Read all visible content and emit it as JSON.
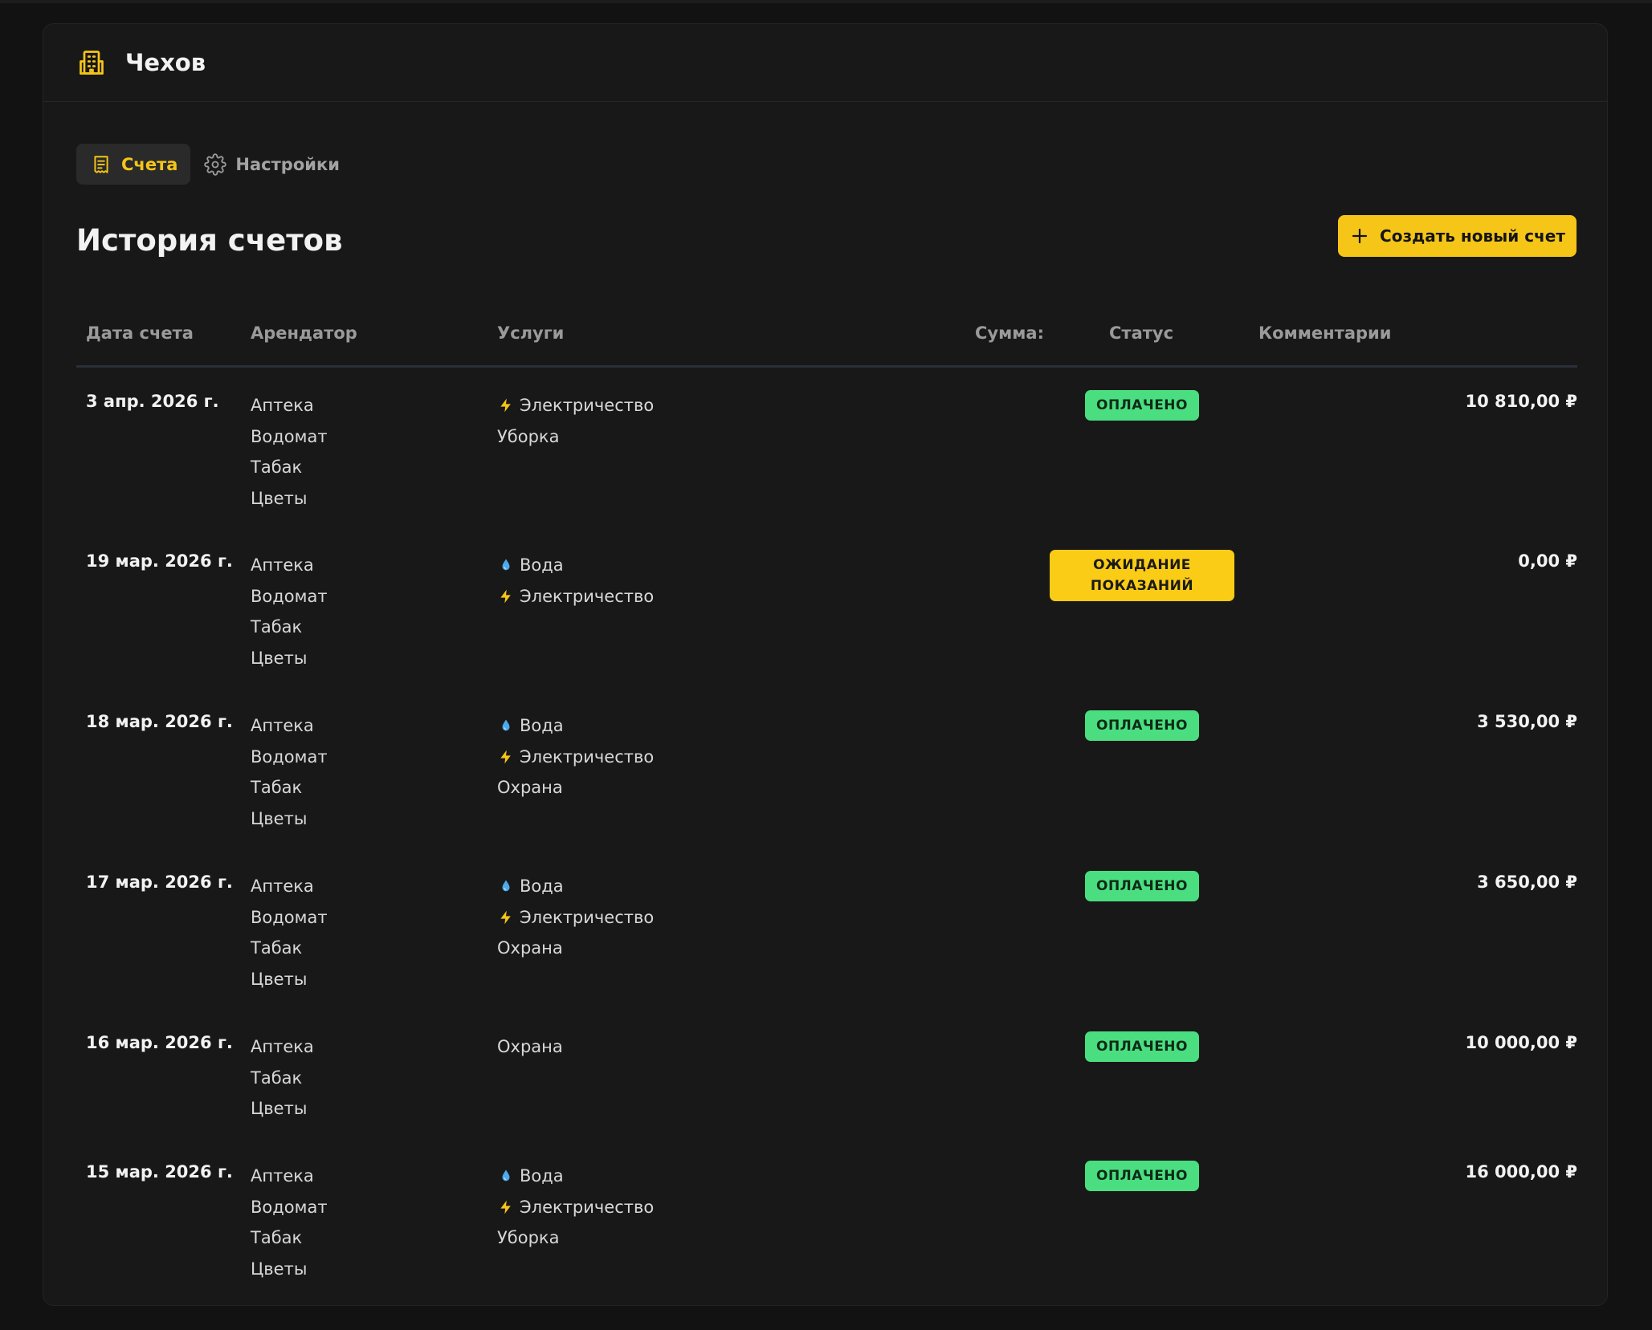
{
  "header": {
    "title": "Чехов",
    "icon": "building-icon"
  },
  "tabs": [
    {
      "label": "Счета",
      "icon": "receipt-icon",
      "active": true
    },
    {
      "label": "Настройки",
      "icon": "gear-icon",
      "active": false
    }
  ],
  "page": {
    "title": "История счетов",
    "create_button": "Создать новый счет"
  },
  "table": {
    "columns": {
      "date": "Дата счета",
      "tenant": "Арендатор",
      "services": "Услуги",
      "amount": "Сумма:",
      "status": "Статус",
      "comments": "Комментарии"
    },
    "rows": [
      {
        "date": "3 апр. 2026 г.",
        "tenants": [
          "Аптека",
          "Водомат",
          "Табак",
          "Цветы"
        ],
        "services": [
          {
            "icon": "lightning-icon",
            "name": "Электричество"
          },
          {
            "icon": "",
            "name": "Уборка"
          }
        ],
        "amount": "10 810,00 ₽",
        "status": [
          "ОПЛАЧЕНО"
        ]
      },
      {
        "date": "19 мар. 2026 г.",
        "tenants": [
          "Аптека",
          "Водомат",
          "Табак",
          "Цветы"
        ],
        "services": [
          {
            "icon": "water-drop-icon",
            "name": "Вода"
          },
          {
            "icon": "lightning-icon",
            "name": "Электричество"
          }
        ],
        "amount": "0,00 ₽",
        "status": [
          "ОЖИДАНИЕ",
          "ПОКАЗАНИЙ"
        ]
      },
      {
        "date": "18 мар. 2026 г.",
        "tenants": [
          "Аптека",
          "Водомат",
          "Табак",
          "Цветы"
        ],
        "services": [
          {
            "icon": "water-drop-icon",
            "name": "Вода"
          },
          {
            "icon": "lightning-icon",
            "name": "Электричество"
          },
          {
            "icon": "",
            "name": "Охрана"
          }
        ],
        "amount": "3 530,00 ₽",
        "status": [
          "ОПЛАЧЕНО"
        ]
      },
      {
        "date": "17 мар. 2026 г.",
        "tenants": [
          "Аптека",
          "Водомат",
          "Табак",
          "Цветы"
        ],
        "services": [
          {
            "icon": "water-drop-icon",
            "name": "Вода"
          },
          {
            "icon": "lightning-icon",
            "name": "Электричество"
          },
          {
            "icon": "",
            "name": "Охрана"
          }
        ],
        "amount": "3 650,00 ₽",
        "status": [
          "ОПЛАЧЕНО"
        ]
      },
      {
        "date": "16 мар. 2026 г.",
        "tenants": [
          "Аптека",
          "Табак",
          "Цветы"
        ],
        "services": [
          {
            "icon": "",
            "name": "Охрана"
          }
        ],
        "amount": "10 000,00 ₽",
        "status": [
          "ОПЛАЧЕНО"
        ]
      },
      {
        "date": "15 мар. 2026 г.",
        "tenants": [
          "Аптека",
          "Водомат",
          "Табак",
          "Цветы"
        ],
        "services": [
          {
            "icon": "water-drop-icon",
            "name": "Вода"
          },
          {
            "icon": "lightning-icon",
            "name": "Электричество"
          },
          {
            "icon": "",
            "name": "Уборка"
          }
        ],
        "amount": "16 000,00 ₽",
        "status": [
          "ОПЛАЧЕНО"
        ]
      }
    ]
  },
  "colors": {
    "accent": "#f5c518",
    "paid": "#4ade80",
    "pending": "#facc15"
  }
}
